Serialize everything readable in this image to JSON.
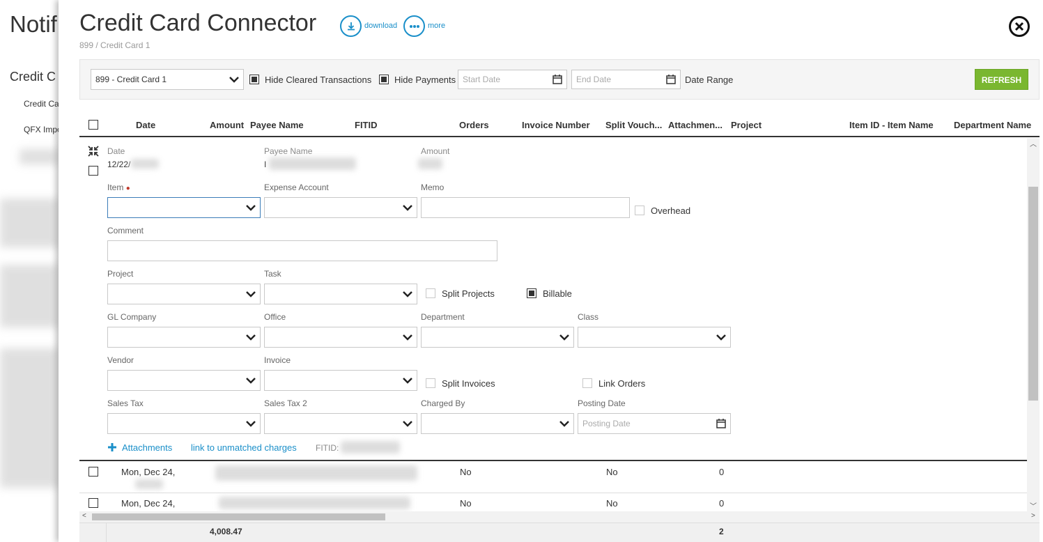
{
  "background": {
    "title": "Notifi",
    "section": "Credit C",
    "links": [
      "Credit Ca",
      "QFX Impo"
    ]
  },
  "panel": {
    "title": "Credit Card Connector",
    "breadcrumb": "899 / Credit Card 1",
    "download_label": "download",
    "more_label": "more",
    "download_icon": "download-icon",
    "more_icon": "more-icon",
    "close_icon": "close-icon"
  },
  "filters": {
    "account_value": "899 - Credit Card 1",
    "hide_cleared_label": "Hide Cleared Transactions",
    "hide_cleared_checked": true,
    "hide_payments_label": "Hide Payments",
    "hide_payments_checked": true,
    "start_date_placeholder": "Start Date",
    "end_date_placeholder": "End Date",
    "date_range_label": "Date Range",
    "refresh_label": "REFRESH"
  },
  "columns": [
    "Date",
    "Amount",
    "Payee Name",
    "FITID",
    "Orders",
    "Invoice Number",
    "Split Vouch...",
    "Attachmen...",
    "Project",
    "Item ID - Item Name",
    "Department Name"
  ],
  "edit": {
    "date_label": "Date",
    "date_value": "12/22/",
    "payee_label": "Payee Name",
    "payee_value": "I",
    "amount_label": "Amount",
    "item_label": "Item",
    "expense_account_label": "Expense Account",
    "memo_label": "Memo",
    "overhead_label": "Overhead",
    "comment_label": "Comment",
    "project_label": "Project",
    "task_label": "Task",
    "split_projects_label": "Split Projects",
    "billable_label": "Billable",
    "gl_company_label": "GL Company",
    "office_label": "Office",
    "department_label": "Department",
    "class_label": "Class",
    "vendor_label": "Vendor",
    "invoice_label": "Invoice",
    "split_invoices_label": "Split Invoices",
    "link_orders_label": "Link Orders",
    "sales_tax_label": "Sales Tax",
    "sales_tax_2_label": "Sales Tax 2",
    "charged_by_label": "Charged By",
    "posting_date_label": "Posting Date",
    "posting_date_placeholder": "Posting Date",
    "attachments_link": "Attachments",
    "unmatched_link": "link to unmatched charges",
    "fitid_label": "FITID:"
  },
  "rows": [
    {
      "date": "Mon, Dec 24,",
      "orders": "No",
      "split": "No",
      "attachments": "0"
    },
    {
      "date": "Mon, Dec 24,",
      "orders": "No",
      "split": "No",
      "attachments": "0"
    }
  ],
  "totals": {
    "amount": "4,008.47",
    "attachments": "2"
  }
}
